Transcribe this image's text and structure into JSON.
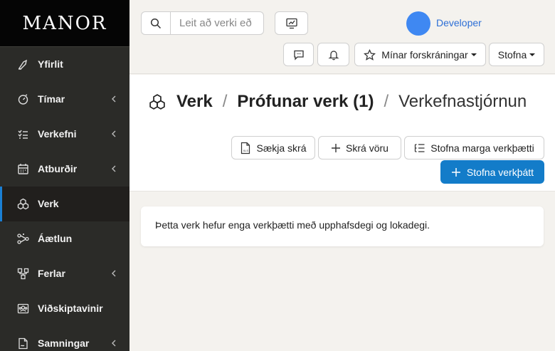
{
  "brand": {
    "name": "MANOR"
  },
  "sidebar": {
    "items": [
      {
        "label": "Yfirlit",
        "icon": "dashboard-icon",
        "has_submenu": false,
        "active": false
      },
      {
        "label": "Tímar",
        "icon": "timer-icon",
        "has_submenu": true,
        "active": false
      },
      {
        "label": "Verkefni",
        "icon": "tasks-icon",
        "has_submenu": true,
        "active": false
      },
      {
        "label": "Atburðir",
        "icon": "calendar-icon",
        "has_submenu": true,
        "active": false
      },
      {
        "label": "Verk",
        "icon": "cubes-icon",
        "has_submenu": false,
        "active": true
      },
      {
        "label": "Áætlun",
        "icon": "plan-icon",
        "has_submenu": false,
        "active": false
      },
      {
        "label": "Ferlar",
        "icon": "process-icon",
        "has_submenu": true,
        "active": false
      },
      {
        "label": "Viðskiptavinir",
        "icon": "customers-icon",
        "has_submenu": false,
        "active": false
      },
      {
        "label": "Samningar",
        "icon": "contract-icon",
        "has_submenu": true,
        "active": false
      }
    ]
  },
  "topbar": {
    "search_placeholder": "Leit að verki eð",
    "user_name": "Developer",
    "favorites_label": "Mínar forskráningar",
    "create_label": "Stofna"
  },
  "breadcrumb": {
    "root": "Verk",
    "project": "Prófunar verk (1)",
    "current": "Verkefnastjórnun"
  },
  "actions": {
    "download_label": "Sækja skrá",
    "register_item_label": "Skrá vöru",
    "create_many_label": "Stofna marga verkþætti",
    "create_one_label": "Stofna verkþátt"
  },
  "main": {
    "empty_message": "Þetta verk hefur enga verkþætti með upphafsdegi og lokadegi."
  },
  "colors": {
    "sidebar_bg": "#2b2b28",
    "brand_bg": "#050505",
    "accent": "#137cc9",
    "avatar": "#3f88f2",
    "user_link": "#2d6fd6"
  }
}
